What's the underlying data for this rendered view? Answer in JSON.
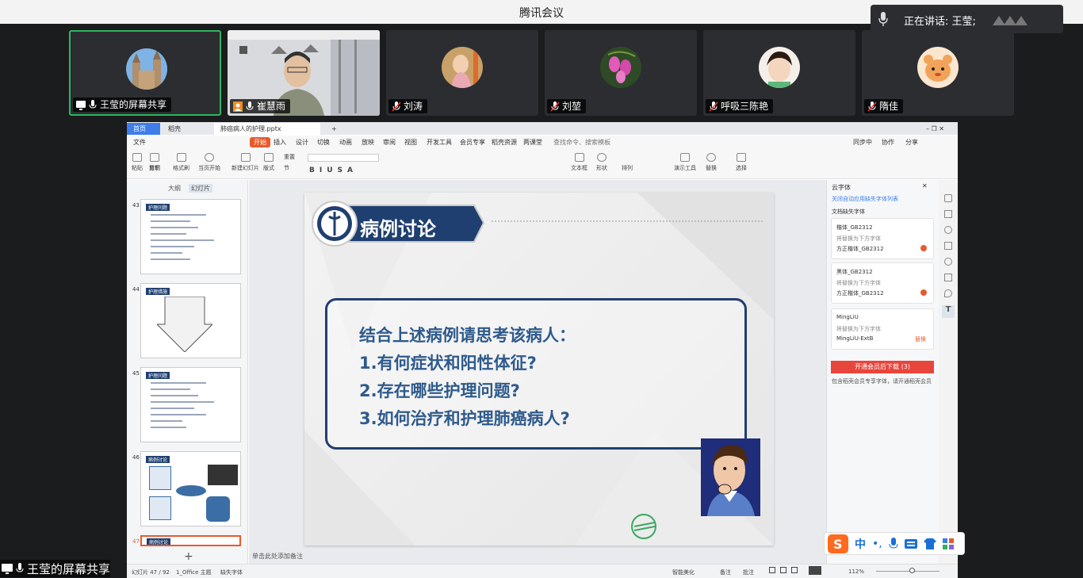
{
  "meeting": {
    "app_title": "腾讯会议",
    "speaking_text": "正在讲话: 王莹;",
    "share_label": "王莹的屏幕共享"
  },
  "participants": [
    {
      "name": "王莹的屏幕共享",
      "type": "screen-share",
      "active": true
    },
    {
      "name": "崔慧雨",
      "type": "video"
    },
    {
      "name": "刘涛",
      "type": "muted"
    },
    {
      "name": "刘堃",
      "type": "muted"
    },
    {
      "name": "呼吸三陈艳",
      "type": "muted"
    },
    {
      "name": "隋佳",
      "type": "muted"
    }
  ],
  "ppt": {
    "tabs": [
      "首页",
      "稻壳",
      "肺癌病人的护理.pptx"
    ],
    "menu": [
      "文件",
      "开始",
      "插入",
      "设计",
      "切换",
      "动画",
      "放映",
      "审阅",
      "视图",
      "开发工具",
      "会员专享",
      "稻壳资源",
      "两课堂"
    ],
    "menu_selected": "开始",
    "search_hint": "查找命令、搜索模板",
    "right_actions": [
      "同步中",
      "协作",
      "分享"
    ],
    "toolbar": [
      "粘贴",
      "剪切",
      "复制",
      "格式刷",
      "当页开始",
      "新建幻灯片",
      "版式",
      "节",
      "重置",
      "文本框",
      "形状",
      "排列",
      "演示工具",
      "替换",
      "选择"
    ],
    "pane_tabs": [
      "大纲",
      "幻灯片"
    ],
    "thumbnails": [
      {
        "num": "43",
        "title": "护理问题",
        "selected": false
      },
      {
        "num": "44",
        "title": "护理措施",
        "selected": false
      },
      {
        "num": "45",
        "title": "护理问题",
        "selected": false
      },
      {
        "num": "46",
        "title": "病例讨论",
        "selected": false
      },
      {
        "num": "47",
        "title": "病例讨论",
        "selected": true
      }
    ],
    "slide": {
      "title": "病例讨论",
      "questions": [
        "结合上述病例请思考该病人：",
        "1.有何症状和阳性体征?",
        "2.存在哪些护理问题?",
        "3.如何治疗和护理肺癌病人?"
      ]
    },
    "notes_placeholder": "单击此处添加备注",
    "font_panel": {
      "header": "云字体",
      "link": "关闭自动应用缺失字体列表",
      "section": "文档缺失字体",
      "fonts": [
        {
          "name": "楷体_GB2312",
          "hint": "将替换为下方字体",
          "replacement": "方正楷体_GB2312"
        },
        {
          "name": "黑体_GB2312",
          "hint": "将替换为下方字体",
          "replacement": "方正楷体_GB2312"
        },
        {
          "name": "MingLiU",
          "hint": "将替换为下方字体",
          "replacement": "MingLiU-ExtB",
          "action": "替换"
        }
      ],
      "button": "开通会员后下载 (3)",
      "footer": "包含稻壳会员专享字体，请开通稻壳会员"
    },
    "status": {
      "slide_pos": "幻灯片 47 / 92",
      "theme": "1_Office 主题",
      "missing_font": "缺失字体",
      "beautify": "智能美化",
      "notes": "备注",
      "comments": "批注",
      "zoom": "112%"
    }
  },
  "ime": {
    "lang": "中"
  },
  "colors": {
    "accent_green": "#2db55d",
    "wps_orange": "#e85a2c",
    "slide_blue": "#1f3f70",
    "question_blue": "#2e5a8c"
  }
}
